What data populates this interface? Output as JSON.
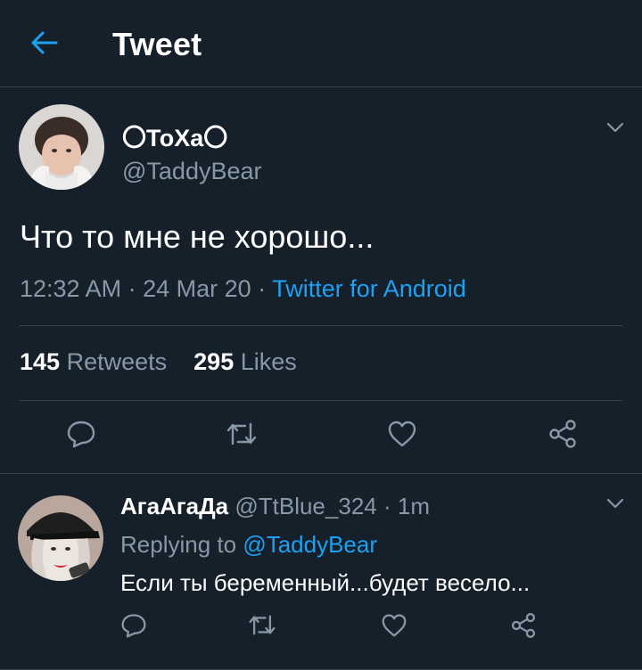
{
  "header": {
    "title": "Tweet"
  },
  "tweet": {
    "author_name": "〇ТоХа〇",
    "author_handle": "@TaddyBear",
    "text": "Что то мне не хорошо...",
    "time": "12:32 AM",
    "date": "24 Mar 20",
    "separator": "·",
    "source": "Twitter for Android",
    "retweets_count": "145",
    "retweets_label": "Retweets",
    "likes_count": "295",
    "likes_label": "Likes"
  },
  "reply": {
    "author_name": "АгаАгаДа",
    "author_handle": "@TtBlue_324",
    "separator": "·",
    "time": "1m",
    "replying_label": "Replying to",
    "replying_to": "@TaddyBear",
    "text": "Если ты беременный...будет весело..."
  },
  "icons": {
    "back": "arrow-left-icon",
    "caret": "chevron-down-icon",
    "reply": "comment-icon",
    "retweet": "retweet-icon",
    "like": "heart-icon",
    "share": "share-icon"
  },
  "colors": {
    "background": "#15202b",
    "accent": "#1da1f2",
    "secondary_text": "#8899a6",
    "divider": "#38444d"
  }
}
